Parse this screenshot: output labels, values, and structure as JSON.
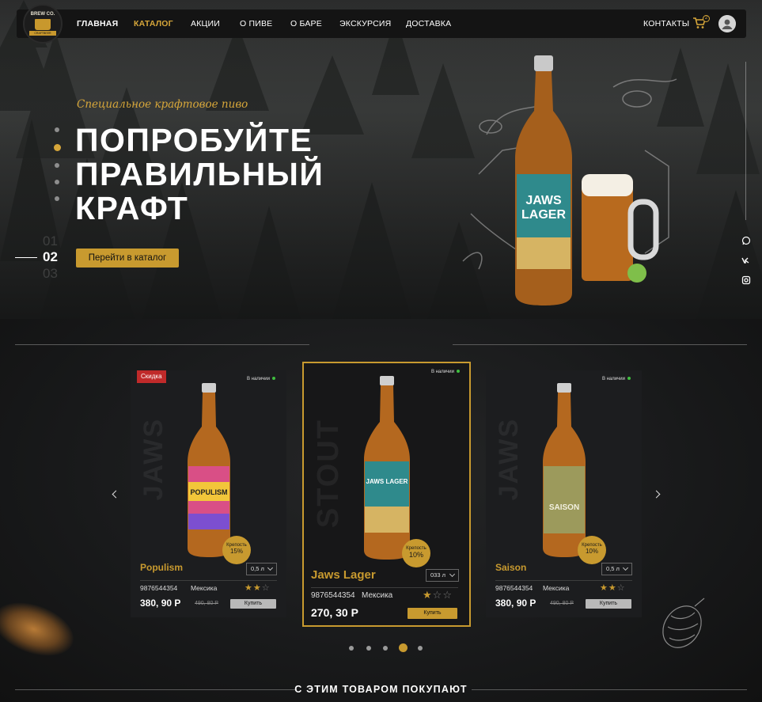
{
  "brand": {
    "logo_top": "BREW CO.",
    "logo_ribbon": "CRAFTBEER"
  },
  "nav": {
    "items": [
      {
        "label": "ГЛАВНАЯ"
      },
      {
        "label": "КАТАЛОГ"
      },
      {
        "label": "АКЦИИ"
      },
      {
        "label": "О ПИВЕ"
      },
      {
        "label": "О БАРЕ"
      },
      {
        "label": "ЭКСКУРСИЯ"
      },
      {
        "label": "ДОСТАВКА"
      }
    ],
    "contacts": "КОНТАКТЫ",
    "cart_count": "2",
    "active_item": "КАТАЛОГ"
  },
  "hero": {
    "subtitle": "Специальное крафтовое пиво",
    "headline": [
      "ПОПРОБУЙТЕ",
      "ПРАВИЛЬНЫЙ",
      "КРАФТ"
    ],
    "slides": [
      "01",
      "02",
      "03"
    ],
    "active_slide": "02",
    "cta": "Перейти в каталог",
    "bottle_label": [
      "JAWS",
      "LAGER"
    ]
  },
  "social": [
    {
      "icon": "whatsapp-icon"
    },
    {
      "icon": "vk-icon"
    },
    {
      "icon": "instagram-icon"
    }
  ],
  "products": [
    {
      "name": "Populism",
      "badge": "Скидка",
      "stock": "В наличии",
      "watermark": "JAWS",
      "strength_label": "Крепость",
      "strength": "15%",
      "volume": "0,5 л",
      "sku": "9876544354",
      "country": "Мексика",
      "rating": 2,
      "price": "380, 90 Р",
      "old_price": "490, 80 Р",
      "buy": "Купить",
      "label_text": "POPULISM"
    },
    {
      "name": "Jaws Lager",
      "stock": "В наличии",
      "watermark": "STOUT",
      "strength_label": "Крепость",
      "strength": "10%",
      "volume": "033 л",
      "sku": "9876544354",
      "country": "Мексика",
      "rating": 1,
      "price": "270, 30 Р",
      "buy": "Купить",
      "label_text": "JAWS LAGER"
    },
    {
      "name": "Saison",
      "stock": "В наличии",
      "watermark": "JAWS",
      "strength_label": "Крепость",
      "strength": "10%",
      "volume": "0,5 л",
      "sku": "9876544354",
      "country": "Мексика",
      "rating": 2,
      "price": "380, 90 Р",
      "old_price": "490, 80 Р",
      "buy": "Купить",
      "label_text": "SAISON"
    }
  ],
  "pager": {
    "count": 5,
    "active": 4
  },
  "colors": {
    "accent": "#c89a2f",
    "discount": "#c02a2a",
    "in_stock": "#3fbf3f"
  },
  "bottom_title": "С ЭТИМ ТОВАРОМ ПОКУПАЮТ"
}
